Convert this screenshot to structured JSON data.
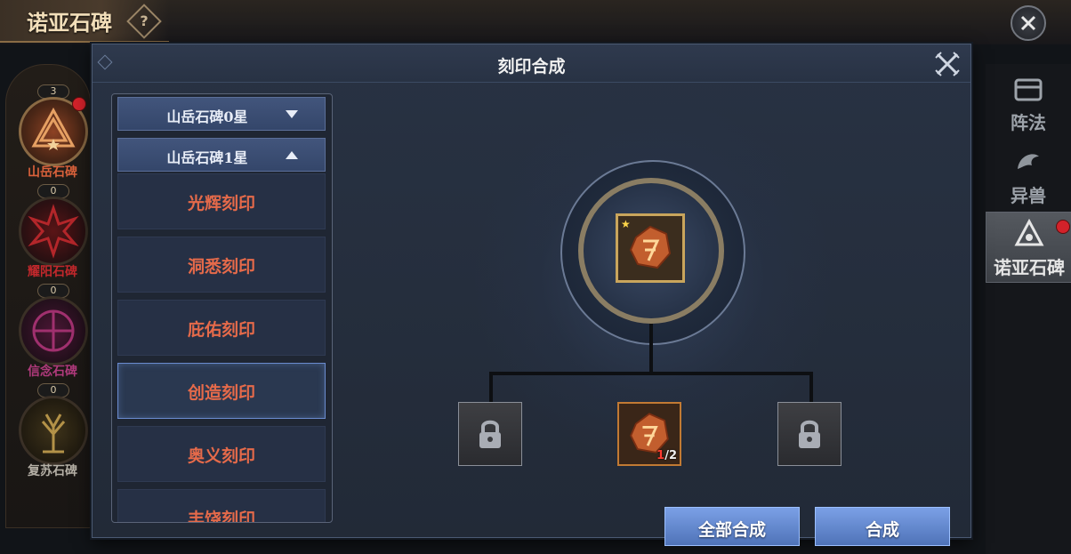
{
  "page": {
    "title": "诺亚石碑",
    "help_icon": "question-icon",
    "close_icon": "close-icon"
  },
  "steles": [
    {
      "name": "山岳石碑",
      "count": "3",
      "color": "#c0562f",
      "has_badge": true
    },
    {
      "name": "耀阳石碑",
      "count": "0",
      "color": "#b3262a",
      "has_badge": false
    },
    {
      "name": "信念石碑",
      "count": "0",
      "color": "#a0306e",
      "has_badge": false
    },
    {
      "name": "复苏石碑",
      "count": "0",
      "color": "#9c7f3c",
      "has_badge": false
    }
  ],
  "right_tabs": [
    {
      "label": "阵法",
      "icon": "formation-icon",
      "active": false
    },
    {
      "label": "异兽",
      "icon": "beast-icon",
      "active": false
    },
    {
      "label": "诺亚石碑",
      "icon": "stele-icon",
      "active": true
    }
  ],
  "modal": {
    "title": "刻印合成",
    "close_icon": "crossed-swords-close-icon"
  },
  "list": {
    "categories": [
      {
        "label": "山岳石碑0星",
        "expanded": false
      },
      {
        "label": "山岳石碑1星",
        "expanded": true
      }
    ],
    "items": [
      {
        "label": "光辉刻印",
        "selected": false
      },
      {
        "label": "洞悉刻印",
        "selected": false
      },
      {
        "label": "庇佑刻印",
        "selected": false
      },
      {
        "label": "创造刻印",
        "selected": true
      },
      {
        "label": "奥义刻印",
        "selected": false
      },
      {
        "label": "丰饶刻印",
        "selected": false
      }
    ]
  },
  "synthesis": {
    "result": {
      "icon": "rune-stone-icon",
      "stars": "★"
    },
    "materials": [
      {
        "state": "locked",
        "icon": "lock-icon"
      },
      {
        "state": "item",
        "icon": "rune-stone-icon",
        "have": "1",
        "need": "/2"
      },
      {
        "state": "locked",
        "icon": "lock-icon"
      }
    ]
  },
  "buttons": {
    "synthesize_all": "全部合成",
    "synthesize": "合成"
  },
  "colors": {
    "item_text": "#e56a4a",
    "button": "#5f86cf",
    "badge": "#d3222a"
  }
}
